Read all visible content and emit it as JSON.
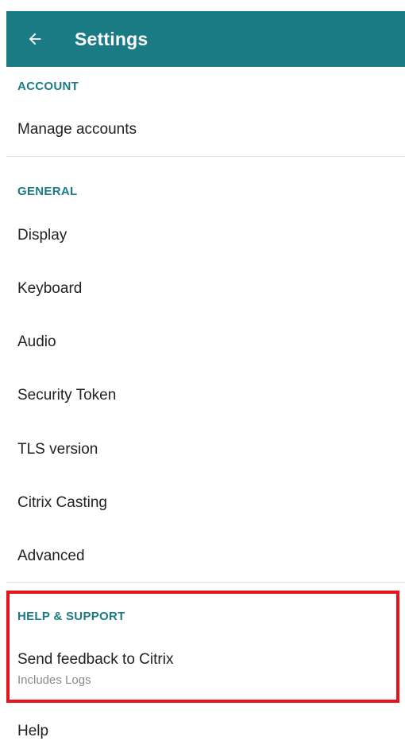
{
  "appbar": {
    "title": "Settings",
    "back_icon": "arrow-back-icon",
    "background_color": "#1b7b84"
  },
  "sections": {
    "account": {
      "header": "ACCOUNT",
      "items": [
        "Manage accounts"
      ]
    },
    "general": {
      "header": "GENERAL",
      "items": [
        "Display",
        "Keyboard",
        "Audio",
        "Security Token",
        "TLS version",
        "Citrix Casting",
        "Advanced"
      ]
    },
    "help_support": {
      "header": "HELP & SUPPORT",
      "feedback": {
        "label": "Send feedback to Citrix",
        "sublabel": "Includes Logs"
      },
      "help": "Help"
    }
  },
  "highlight_color": "#e3141c",
  "accent_color": "#1b7b84"
}
